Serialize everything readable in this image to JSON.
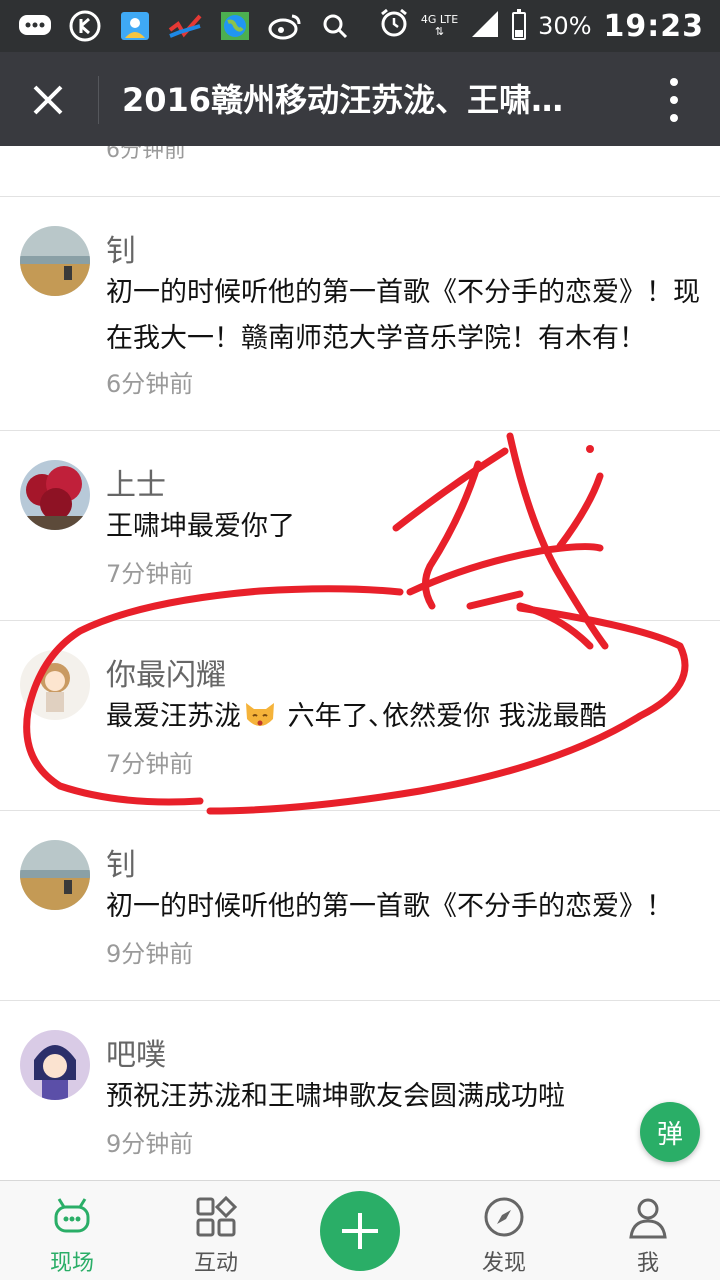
{
  "status_bar": {
    "left_icons": [
      "message-icon",
      "k-app-icon",
      "gallery-icon",
      "signal-app-icon",
      "globe-icon",
      "weibo-icon",
      "search-icon"
    ],
    "network": "4G LTE",
    "battery": "30%",
    "battery_level": 0.3,
    "time": "19:23"
  },
  "header": {
    "title": "2016赣州移动汪苏泷、王啸…",
    "close_icon": "close-icon",
    "more_icon": "more-vertical-icon"
  },
  "feed": {
    "previous_time_partial": "6分钟前",
    "comments": [
      {
        "name": "钊",
        "text": "初一的时候听他的第一首歌《不分手的恋爱》！现在我大一！赣南师范大学音乐学院！有木有！",
        "time": "6分钟前"
      },
      {
        "name": "上士",
        "text": "王啸坤最爱你了",
        "time": "7分钟前"
      },
      {
        "name": "你最闪耀",
        "text_before_emoji": "最爱汪苏泷",
        "text_after_emoji": " 六年了､依然爱你 我泷最酷",
        "time": "7分钟前"
      },
      {
        "name": "钊",
        "text": "初一的时候听他的第一首歌《不分手的恋爱》！",
        "time": "9分钟前"
      },
      {
        "name": "吧噗",
        "text": "预祝汪苏泷和王啸坤歌友会圆满成功啦",
        "time": "9分钟前"
      }
    ],
    "danmu_button": "弹"
  },
  "bottom_nav": {
    "items": [
      {
        "label": "现场",
        "icon": "live-chat-icon",
        "active": true
      },
      {
        "label": "互动",
        "icon": "grid-icon",
        "active": false
      },
      {
        "label": "发现",
        "icon": "compass-icon",
        "active": false
      },
      {
        "label": "我",
        "icon": "person-icon",
        "active": false
      }
    ],
    "add_icon": "plus-icon"
  },
  "colors": {
    "status_bar": "#2f3133",
    "title_bar": "#393a3f",
    "accent_green": "#2aae67",
    "annotation_red": "#e8202a"
  }
}
